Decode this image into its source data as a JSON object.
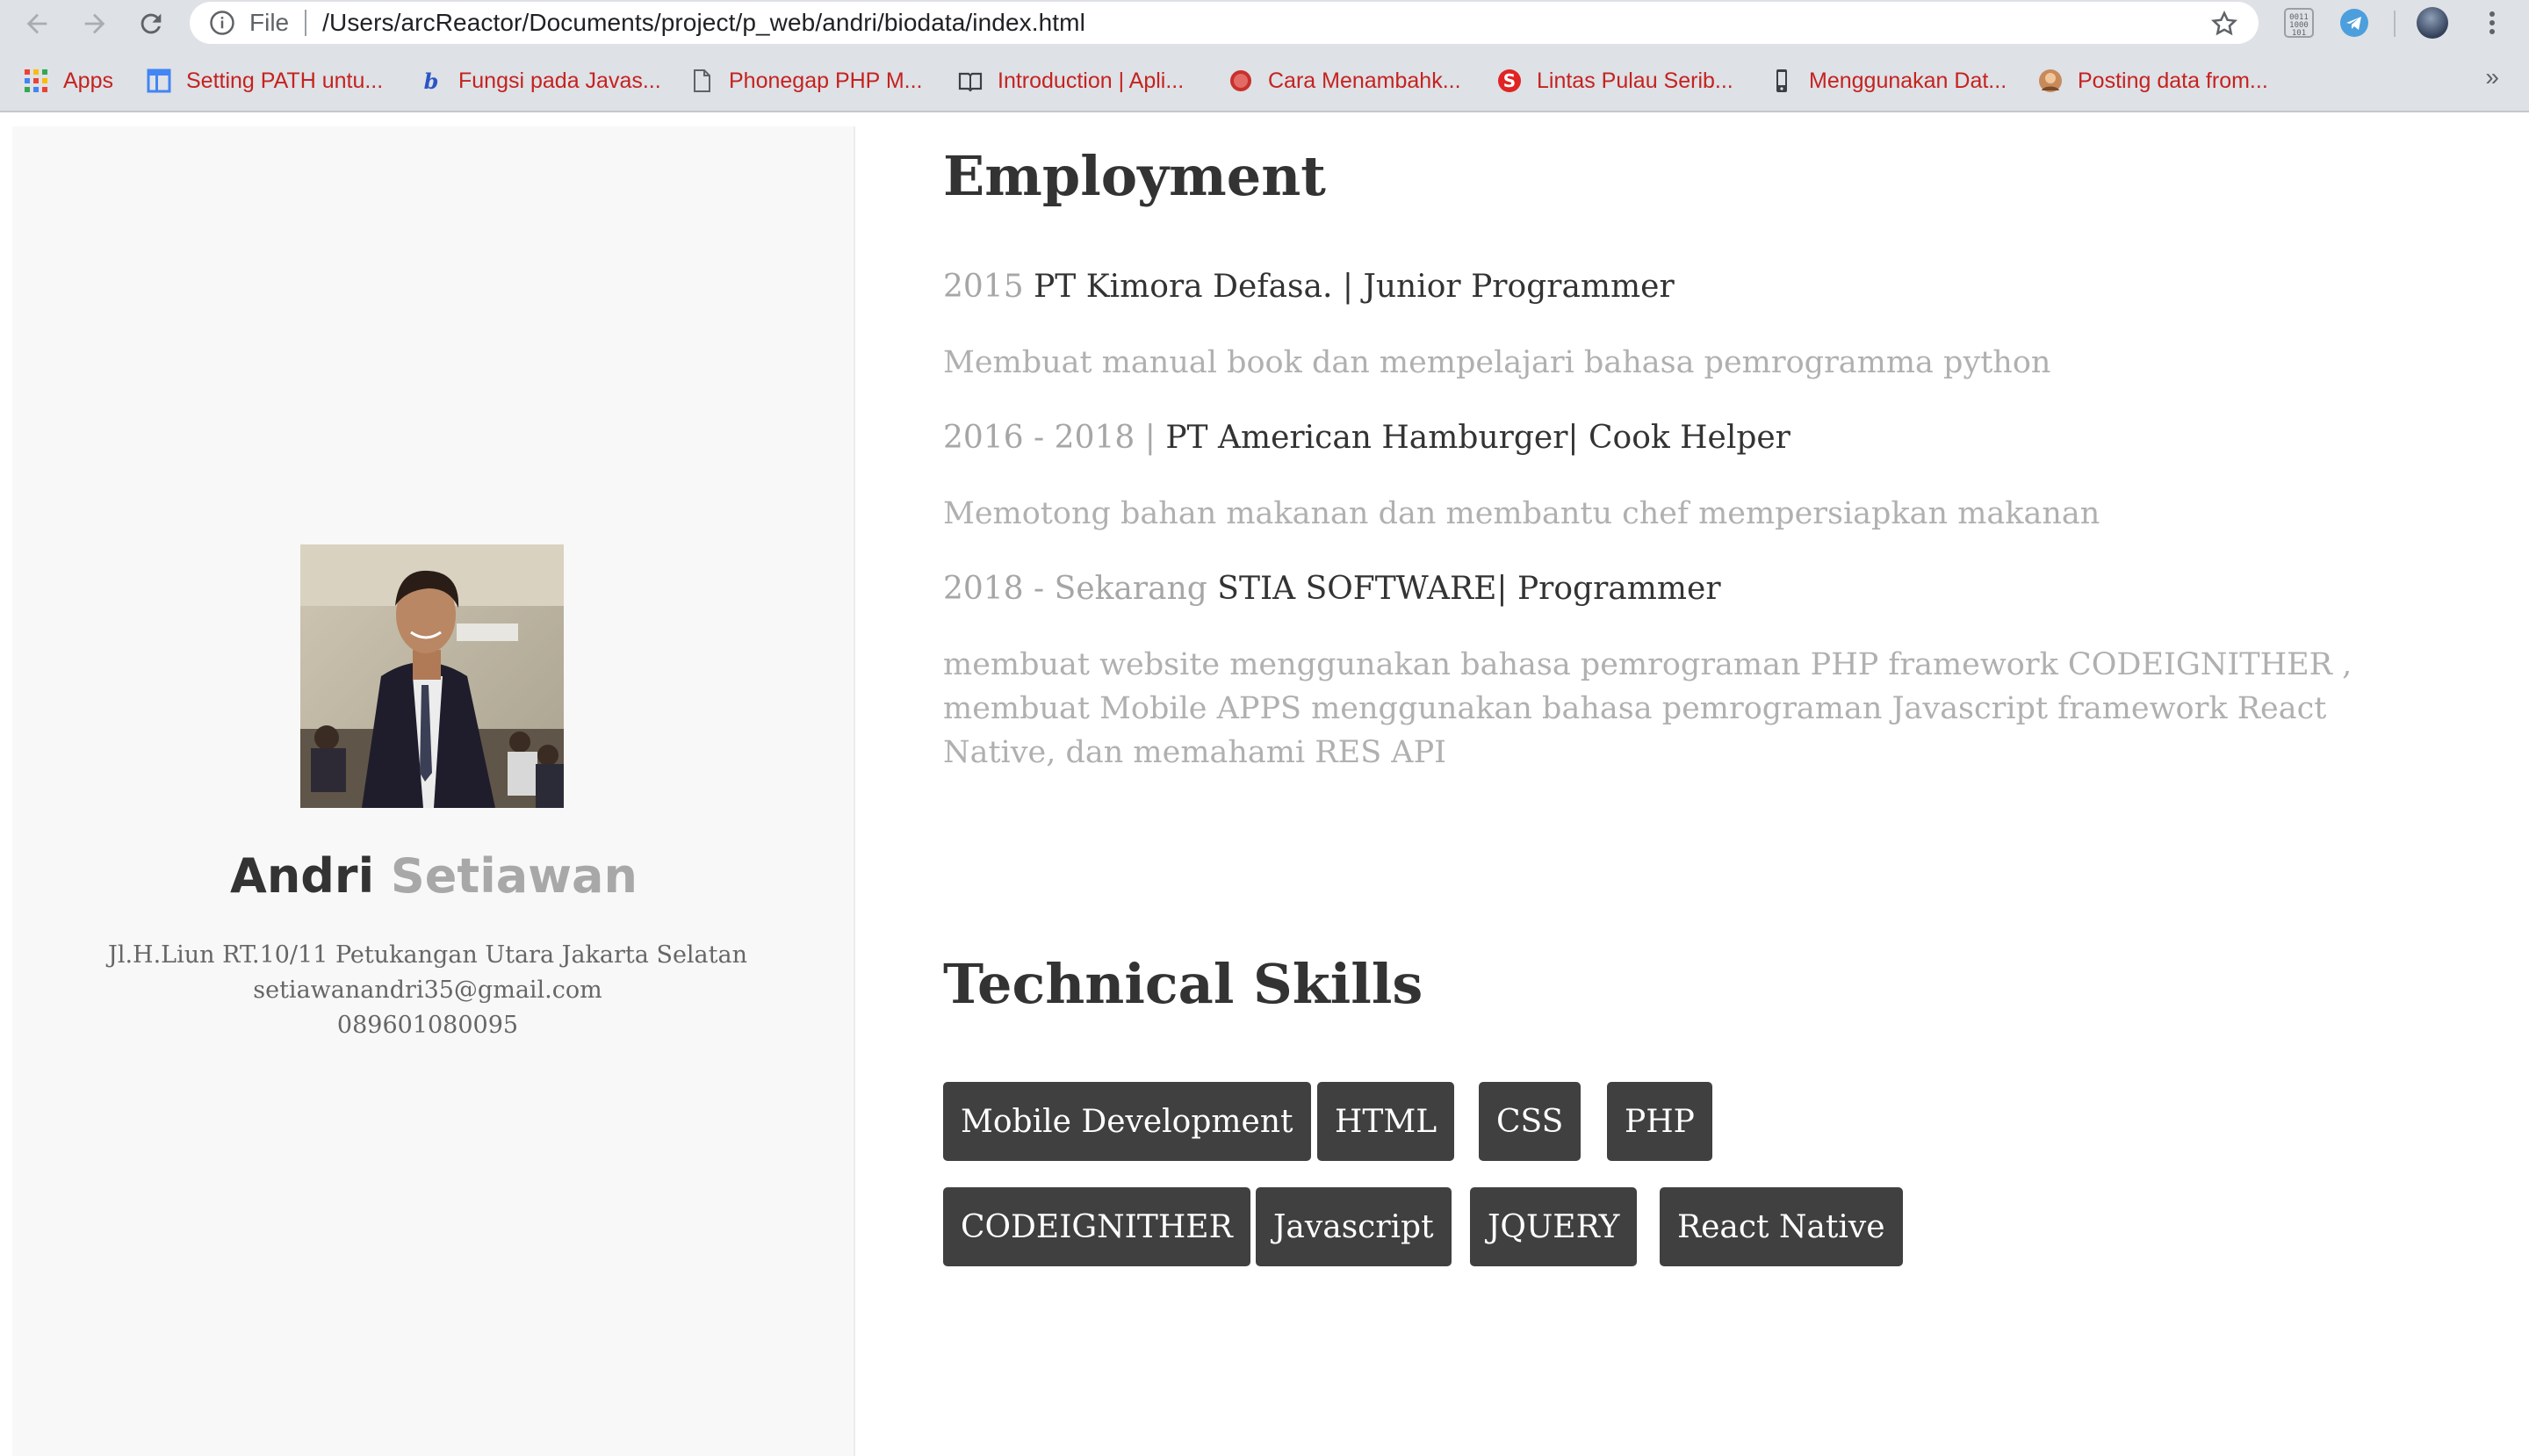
{
  "browser": {
    "address_scheme": "File",
    "url": "/Users/arcReactor/Documents/project/p_web/andri/biodata/index.html"
  },
  "bookmarks": [
    {
      "label": "Apps",
      "icon": "apps-grid-icon"
    },
    {
      "label": "Setting PATH untu...",
      "icon": "page-layout-icon"
    },
    {
      "label": "Fungsi pada Javas...",
      "icon": "bing-icon"
    },
    {
      "label": "Phonegap PHP M...",
      "icon": "document-icon"
    },
    {
      "label": "Introduction | Apli...",
      "icon": "book-icon"
    },
    {
      "label": "Cara Menambahk...",
      "icon": "red-circle-icon"
    },
    {
      "label": "Lintas Pulau Serib...",
      "icon": "s-logo-icon"
    },
    {
      "label": "Menggunakan Dat...",
      "icon": "phone-icon"
    },
    {
      "label": "Posting data from...",
      "icon": "avatar-icon"
    }
  ],
  "bookmarks_overflow": "»",
  "profile": {
    "first_name": "Andri",
    "last_name": "Setiawan",
    "address": "Jl.H.Liun RT.10/11 Petukangan Utara Jakarta Selatan",
    "email": "setiawanandri35@gmail.com",
    "phone": "089601080095"
  },
  "employment": {
    "heading": "Employment",
    "jobs": [
      {
        "period": "2015",
        "title": "PT Kimora Defasa. | Junior Programmer",
        "description": "Membuat manual book dan mempelajari bahasa pemrogramma python"
      },
      {
        "period": "2016 - 2018 |",
        "title": "PT American Hamburger| Cook Helper",
        "description": "Memotong bahan makanan dan membantu chef mempersiapkan makanan"
      },
      {
        "period": "2018 - Sekarang",
        "title": "STIA SOFTWARE| Programmer",
        "description": "membuat website menggunakan bahasa pemrograman PHP framework CODEIGNITHER , membuat Mobile APPS menggunakan bahasa pemrograman Javascript framework React Native, dan memahami RES API"
      }
    ]
  },
  "skills": {
    "heading": "Technical Skills",
    "items": [
      "Mobile Development",
      "HTML",
      "CSS",
      "PHP",
      "CODEIGNITHER",
      "Javascript",
      "JQUERY",
      "React Native"
    ]
  },
  "colors": {
    "chrome": "#dee1e6",
    "bookmark_text": "#c5221f",
    "sidebar_bg": "#f8f8f8",
    "skill_bg": "#404040",
    "heading": "#333333",
    "muted": "#a6a6a6"
  }
}
